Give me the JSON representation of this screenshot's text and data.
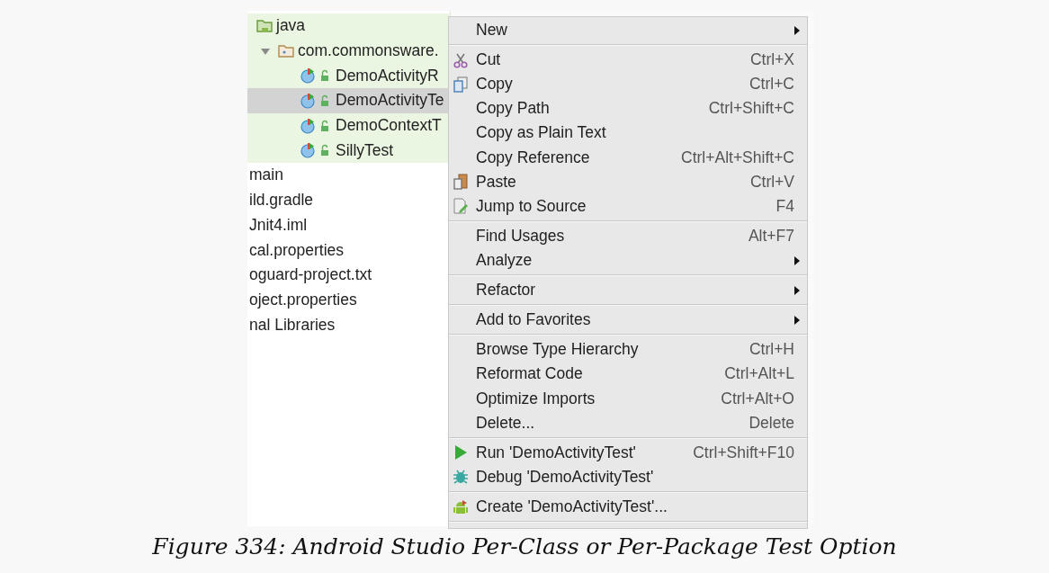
{
  "project_tree": {
    "items": [
      {
        "label": "java",
        "selected": false,
        "children": [
          {
            "label": "com.commonsware.",
            "selected": false,
            "expanded": true,
            "children": [
              {
                "label": "DemoActivityR",
                "selected": false
              },
              {
                "label": "DemoActivityTe",
                "selected": true
              },
              {
                "label": "DemoContextT",
                "selected": false
              },
              {
                "label": "SillyTest",
                "selected": false
              }
            ]
          }
        ]
      },
      {
        "label": "main",
        "selected": false
      },
      {
        "label": "ild.gradle",
        "selected": false
      },
      {
        "label": "Jnit4.iml",
        "selected": false
      },
      {
        "label": "cal.properties",
        "selected": false
      },
      {
        "label": "oguard-project.txt",
        "selected": false
      },
      {
        "label": "oject.properties",
        "selected": false
      },
      {
        "label": "nal Libraries",
        "selected": false
      }
    ]
  },
  "context_menu": {
    "sections": [
      [
        {
          "label": "New",
          "submenu": true
        }
      ],
      [
        {
          "label": "Cut",
          "shortcut": "Ctrl+X"
        },
        {
          "label": "Copy",
          "shortcut": "Ctrl+C"
        },
        {
          "label": "Copy Path",
          "shortcut": "Ctrl+Shift+C"
        },
        {
          "label": "Copy as Plain Text"
        },
        {
          "label": "Copy Reference",
          "shortcut": "Ctrl+Alt+Shift+C"
        },
        {
          "label": "Paste",
          "shortcut": "Ctrl+V"
        },
        {
          "label": "Jump to Source",
          "shortcut": "F4"
        }
      ],
      [
        {
          "label": "Find Usages",
          "shortcut": "Alt+F7"
        },
        {
          "label": "Analyze",
          "submenu": true
        }
      ],
      [
        {
          "label": "Refactor",
          "submenu": true
        }
      ],
      [
        {
          "label": "Add to Favorites",
          "submenu": true
        }
      ],
      [
        {
          "label": "Browse Type Hierarchy",
          "shortcut": "Ctrl+H"
        },
        {
          "label": "Reformat Code",
          "shortcut": "Ctrl+Alt+L"
        },
        {
          "label": "Optimize Imports",
          "shortcut": "Ctrl+Alt+O"
        },
        {
          "label": "Delete...",
          "shortcut": "Delete"
        }
      ],
      [
        {
          "label": "Run 'DemoActivityTest'",
          "shortcut": "Ctrl+Shift+F10"
        },
        {
          "label": "Debug 'DemoActivityTest'"
        }
      ],
      [
        {
          "label": "Create 'DemoActivityTest'..."
        }
      ]
    ]
  },
  "caption": "Figure 334: Android Studio Per-Class or Per-Package Test Option"
}
